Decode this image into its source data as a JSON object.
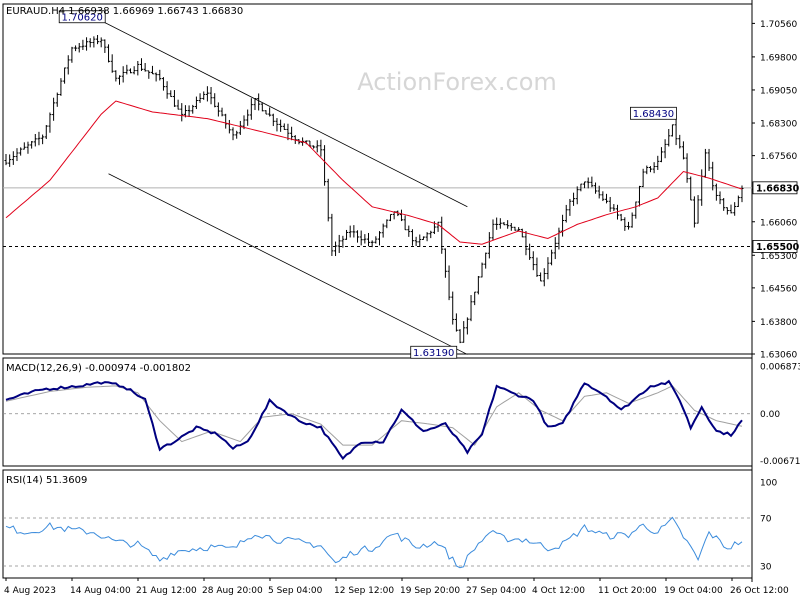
{
  "chart_data": {
    "type": "line",
    "title": "EURAUD.H4  1.66938 1.66969 1.66743 1.66830",
    "watermark": "ActionForex.com",
    "colors": {
      "price": "#000000",
      "ma": "#e0001a",
      "macd": "#000080",
      "signal": "#a0a0a0",
      "rsi": "#3c8cdc",
      "label_text": "#000080",
      "label_bg": "#ffffff",
      "current_price_bg": "#ffffff"
    },
    "price_panel": {
      "ylim": [
        1.6306,
        1.71
      ],
      "yticks": [
        "1.70560",
        "1.69800",
        "1.69050",
        "1.68300",
        "1.67560",
        "1.66800",
        "1.66060",
        "1.65300",
        "1.64560",
        "1.63800",
        "1.63060"
      ],
      "ytick_values": [
        1.7056,
        1.698,
        1.6905,
        1.683,
        1.6756,
        1.668,
        1.6606,
        1.653,
        1.6456,
        1.638,
        1.6306
      ],
      "current_price_label": "1.66830",
      "current_price": 1.6683,
      "support_label": "1.65500",
      "support": 1.655,
      "annotations": [
        {
          "text": "1.70620",
          "bar": 26,
          "value": 1.7062
        },
        {
          "text": "1.68430",
          "bar": 182,
          "value": 1.6843
        },
        {
          "text": "1.63190",
          "bar": 122,
          "value": 1.6319
        }
      ],
      "channel_upper": {
        "bar_start": 26,
        "value_start": 1.7062,
        "bar_end": 126,
        "value_end": 1.664
      },
      "channel_lower": {
        "bar_start": 28,
        "value_start": 1.6715,
        "bar_end": 126,
        "value_end": 1.6305
      },
      "close_anchors": [
        [
          0,
          1.6745
        ],
        [
          10,
          1.68
        ],
        [
          18,
          1.7
        ],
        [
          26,
          1.702
        ],
        [
          30,
          1.693
        ],
        [
          36,
          1.696
        ],
        [
          42,
          1.693
        ],
        [
          48,
          1.6845
        ],
        [
          55,
          1.69
        ],
        [
          62,
          1.68
        ],
        [
          68,
          1.688
        ],
        [
          74,
          1.683
        ],
        [
          80,
          1.679
        ],
        [
          86,
          1.677
        ],
        [
          89,
          1.654
        ],
        [
          94,
          1.6585
        ],
        [
          100,
          1.6555
        ],
        [
          106,
          1.663
        ],
        [
          112,
          1.6555
        ],
        [
          118,
          1.66
        ],
        [
          122,
          1.638
        ],
        [
          124,
          1.633
        ],
        [
          128,
          1.645
        ],
        [
          133,
          1.66
        ],
        [
          140,
          1.659
        ],
        [
          146,
          1.647
        ],
        [
          150,
          1.656
        ],
        [
          154,
          1.665
        ],
        [
          158,
          1.67
        ],
        [
          164,
          1.665
        ],
        [
          170,
          1.659
        ],
        [
          174,
          1.672
        ],
        [
          178,
          1.674
        ],
        [
          182,
          1.682
        ],
        [
          185,
          1.675
        ],
        [
          188,
          1.66
        ],
        [
          191,
          1.676
        ],
        [
          194,
          1.666
        ],
        [
          198,
          1.6623
        ],
        [
          201,
          1.6683
        ]
      ],
      "ma_anchors": [
        [
          0,
          1.6615
        ],
        [
          12,
          1.67
        ],
        [
          26,
          1.685
        ],
        [
          30,
          1.688
        ],
        [
          40,
          1.6855
        ],
        [
          55,
          1.684
        ],
        [
          70,
          1.681
        ],
        [
          82,
          1.6785
        ],
        [
          92,
          1.67
        ],
        [
          100,
          1.664
        ],
        [
          110,
          1.662
        ],
        [
          118,
          1.66
        ],
        [
          124,
          1.656
        ],
        [
          130,
          1.6555
        ],
        [
          140,
          1.6585
        ],
        [
          148,
          1.6568
        ],
        [
          156,
          1.66
        ],
        [
          164,
          1.6622
        ],
        [
          172,
          1.664
        ],
        [
          178,
          1.666
        ],
        [
          185,
          1.672
        ],
        [
          192,
          1.6705
        ],
        [
          201,
          1.668
        ]
      ],
      "bar_range": 0.0016,
      "bar_count": 202
    },
    "macd_panel": {
      "label": "MACD(12,26,9) -0.000974 -0.001802",
      "ylim": [
        -0.0075,
        0.008
      ],
      "yticks": [
        "0.006873",
        "0.00",
        "-0.006716"
      ],
      "ytick_values": [
        0.006873,
        0.0,
        -0.006716
      ],
      "dotted_levels": [
        0.0
      ],
      "macd_anchors": [
        [
          0,
          0.002
        ],
        [
          10,
          0.0035
        ],
        [
          20,
          0.004
        ],
        [
          26,
          0.0045
        ],
        [
          32,
          0.004
        ],
        [
          38,
          0.002
        ],
        [
          42,
          -0.005
        ],
        [
          46,
          -0.004
        ],
        [
          52,
          -0.002
        ],
        [
          58,
          -0.003
        ],
        [
          62,
          -0.005
        ],
        [
          66,
          -0.004
        ],
        [
          72,
          0.0018
        ],
        [
          80,
          -0.001
        ],
        [
          86,
          -0.002
        ],
        [
          92,
          -0.0065
        ],
        [
          97,
          -0.004
        ],
        [
          103,
          -0.004
        ],
        [
          108,
          0.0005
        ],
        [
          114,
          -0.0025
        ],
        [
          120,
          -0.0015
        ],
        [
          126,
          -0.0055
        ],
        [
          130,
          -0.003
        ],
        [
          134,
          0.004
        ],
        [
          138,
          0.003
        ],
        [
          144,
          0.002
        ],
        [
          148,
          -0.002
        ],
        [
          152,
          -0.0015
        ],
        [
          158,
          0.0045
        ],
        [
          164,
          0.0025
        ],
        [
          168,
          0.0005
        ],
        [
          176,
          0.004
        ],
        [
          181,
          0.0045
        ],
        [
          184,
          0.002
        ],
        [
          187,
          -0.002
        ],
        [
          190,
          0.001
        ],
        [
          194,
          -0.0025
        ],
        [
          198,
          -0.003
        ],
        [
          201,
          -0.001
        ]
      ],
      "signal_anchors": [
        [
          0,
          0.0018
        ],
        [
          12,
          0.0032
        ],
        [
          22,
          0.0038
        ],
        [
          30,
          0.004
        ],
        [
          36,
          0.003
        ],
        [
          42,
          -0.001
        ],
        [
          48,
          -0.004
        ],
        [
          56,
          -0.0025
        ],
        [
          64,
          -0.004
        ],
        [
          70,
          -0.0005
        ],
        [
          78,
          0.0
        ],
        [
          86,
          -0.0015
        ],
        [
          92,
          -0.0045
        ],
        [
          100,
          -0.0045
        ],
        [
          108,
          -0.001
        ],
        [
          116,
          -0.0015
        ],
        [
          122,
          -0.002
        ],
        [
          128,
          -0.0045
        ],
        [
          134,
          0.001
        ],
        [
          140,
          0.003
        ],
        [
          146,
          0.0005
        ],
        [
          152,
          -0.001
        ],
        [
          158,
          0.0025
        ],
        [
          164,
          0.003
        ],
        [
          170,
          0.0015
        ],
        [
          178,
          0.003
        ],
        [
          182,
          0.004
        ],
        [
          188,
          0.0005
        ],
        [
          194,
          -0.001
        ],
        [
          201,
          -0.0018
        ]
      ]
    },
    "rsi_panel": {
      "label": "RSI(14) 51.3609",
      "ylim": [
        20,
        110
      ],
      "yticks": [
        "100",
        "70",
        "30"
      ],
      "ytick_values": [
        100,
        70,
        30
      ],
      "dotted_levels": [
        70,
        30
      ],
      "rsi_anchors": [
        [
          0,
          62
        ],
        [
          6,
          58
        ],
        [
          12,
          63
        ],
        [
          18,
          60
        ],
        [
          24,
          58
        ],
        [
          30,
          50
        ],
        [
          36,
          48
        ],
        [
          42,
          35
        ],
        [
          46,
          42
        ],
        [
          50,
          44
        ],
        [
          56,
          46
        ],
        [
          62,
          44
        ],
        [
          68,
          58
        ],
        [
          74,
          52
        ],
        [
          80,
          50
        ],
        [
          86,
          47
        ],
        [
          90,
          32
        ],
        [
          95,
          42
        ],
        [
          100,
          45
        ],
        [
          106,
          57
        ],
        [
          112,
          46
        ],
        [
          118,
          50
        ],
        [
          122,
          35
        ],
        [
          124,
          28
        ],
        [
          128,
          45
        ],
        [
          132,
          58
        ],
        [
          136,
          53
        ],
        [
          142,
          52
        ],
        [
          148,
          45
        ],
        [
          152,
          48
        ],
        [
          158,
          62
        ],
        [
          164,
          55
        ],
        [
          170,
          56
        ],
        [
          174,
          64
        ],
        [
          178,
          58
        ],
        [
          182,
          68
        ],
        [
          186,
          50
        ],
        [
          189,
          35
        ],
        [
          192,
          58
        ],
        [
          197,
          45
        ],
        [
          201,
          51
        ]
      ]
    },
    "x_axis": {
      "labels": [
        "4 Aug 2023",
        "14 Aug 04:00",
        "21 Aug 12:00",
        "28 Aug 20:00",
        "5 Sep 04:00",
        "12 Sep 12:00",
        "19 Sep 20:00",
        "27 Sep 04:00",
        "4 Oct 12:00",
        "11 Oct 20:00",
        "19 Oct 04:00",
        "26 Oct 12:00"
      ]
    }
  }
}
